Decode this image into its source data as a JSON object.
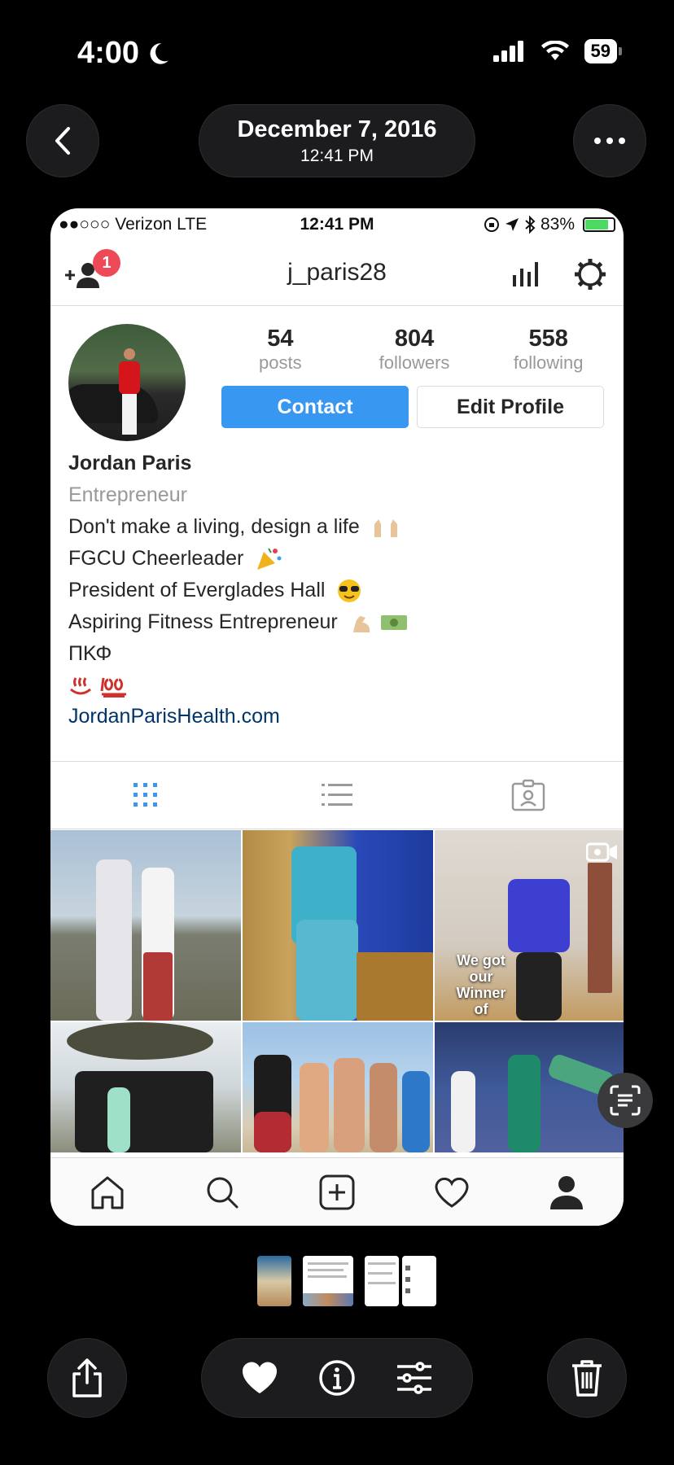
{
  "device_status": {
    "time": "4:00",
    "battery": "59"
  },
  "viewer": {
    "date": "December 7, 2016",
    "time": "12:41 PM"
  },
  "screenshot": {
    "ios_status": {
      "carrier": "●●○○○ Verizon  LTE",
      "time": "12:41 PM",
      "battery_pct": "83%"
    },
    "header": {
      "username": "j_paris28",
      "notification_count": "1"
    },
    "stats": [
      {
        "value": "54",
        "label": "posts"
      },
      {
        "value": "804",
        "label": "followers"
      },
      {
        "value": "558",
        "label": "following"
      }
    ],
    "buttons": {
      "contact": "Contact",
      "edit_profile": "Edit Profile"
    },
    "bio": {
      "name": "Jordan Paris",
      "category": "Entrepreneur",
      "lines": [
        "Don't make a living, design a life",
        "FGCU Cheerleader",
        "President of Everglades Hall",
        "Aspiring Fitness Entrepreneur",
        "ΠΚΦ"
      ],
      "website": "JordanParisHealth.com"
    },
    "grid_overlay_text": "We got our Winner of"
  },
  "colors": {
    "ig_blue": "#3897f0",
    "badge_red": "#ed4956",
    "link_blue": "#003569"
  }
}
